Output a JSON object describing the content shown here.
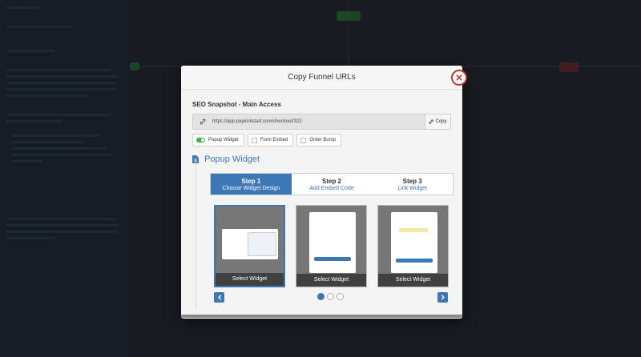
{
  "modal": {
    "title": "Copy Funnel URLs",
    "product_name": "SEO Snapshot - Main Access",
    "url": "https://app.paykickstart.com/checkout/322",
    "copy_label": "Copy",
    "tabs": [
      {
        "label": "Popup Widget",
        "active": true
      },
      {
        "label": "Form Embed",
        "active": false
      },
      {
        "label": "Order Bump",
        "active": false
      }
    ],
    "section_title": "Popup Widget",
    "steps": [
      {
        "num": "Step 1",
        "label": "Choose Widget Design",
        "active": true
      },
      {
        "num": "Step 2",
        "label": "Add Embed Code",
        "active": false
      },
      {
        "num": "Step 3",
        "label": "Link Widget",
        "active": false
      }
    ],
    "cards": [
      {
        "label": "Select Widget",
        "selected": true
      },
      {
        "label": "Select Widget",
        "selected": false
      },
      {
        "label": "Select Widget",
        "selected": false
      }
    ],
    "pagination": {
      "pages": 3,
      "current": 1
    }
  },
  "icons": {
    "close": "close-icon",
    "link": "link-icon",
    "document": "document-icon",
    "prev": "chevron-left-icon",
    "next": "chevron-right-icon"
  },
  "colors": {
    "accent": "#3c77b6",
    "close": "#c0392b",
    "toggle_on": "#39b54a"
  }
}
